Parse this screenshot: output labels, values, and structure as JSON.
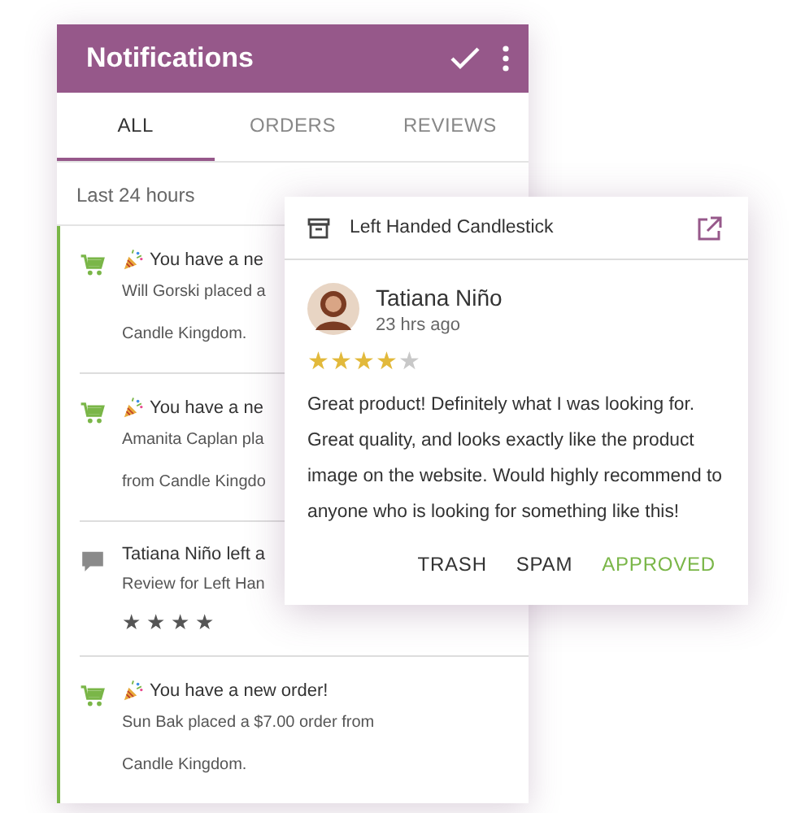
{
  "header": {
    "title": "Notifications"
  },
  "tabs": [
    {
      "label": "ALL",
      "selected": true
    },
    {
      "label": "ORDERS",
      "selected": false
    },
    {
      "label": "REVIEWS",
      "selected": false
    }
  ],
  "section": "Last 24 hours",
  "notifications": [
    {
      "kind": "order",
      "title": "You have a ne",
      "lines": [
        "Will Gorski placed a",
        "Candle Kingdom."
      ]
    },
    {
      "kind": "order",
      "title": "You have a ne",
      "lines": [
        "Amanita Caplan pla",
        "from Candle Kingdo"
      ]
    },
    {
      "kind": "review",
      "title": "Tatiana Niño left a",
      "lines": [
        "Review for Left Han"
      ],
      "stars": 4
    },
    {
      "kind": "order",
      "title": "You have a new order!",
      "lines": [
        "Sun Bak placed a $7.00 order from",
        "Candle Kingdom."
      ]
    }
  ],
  "popup": {
    "product": "Left Handed Candlestick",
    "reviewer": "Tatiana Niño",
    "time": "23 hrs ago",
    "stars": 4,
    "text": "Great product! Definitely what I was looking for. Great quality, and looks exactly like the product image on the website. Would highly recommend to anyone who is looking for something like this!",
    "actions": [
      {
        "label": "TRASH",
        "selected": false
      },
      {
        "label": "SPAM",
        "selected": false
      },
      {
        "label": "APPROVED",
        "selected": true
      }
    ]
  }
}
